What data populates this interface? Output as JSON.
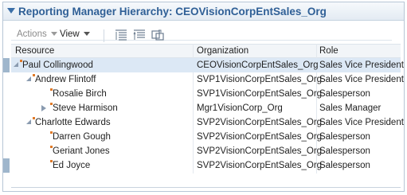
{
  "panel": {
    "title": "Reporting Manager Hierarchy: CEOVisionCorpEntSales_Org"
  },
  "toolbar": {
    "actions_label": "Actions",
    "view_label": "View",
    "icons": [
      "expand-all-icon",
      "collapse-all-icon",
      "detach-icon"
    ]
  },
  "grid": {
    "columns": [
      "Resource",
      "Organization",
      "Role"
    ],
    "rows": [
      {
        "resource": "Paul Collingwood",
        "organization": "CEOVisionCorpEntSales_Org",
        "role": "Sales Vice President"
      },
      {
        "resource": "Andrew Flintoff",
        "organization": "SVP1VisionCorpEntSales_Org",
        "role": "Sales Vice President"
      },
      {
        "resource": "Rosalie Birch",
        "organization": "SVP1VisionCorpEntSales_Org",
        "role": "Salesperson"
      },
      {
        "resource": "Steve Harmison",
        "organization": "Mgr1VisionCorp_Org",
        "role": "Sales Manager"
      },
      {
        "resource": "Charlotte Edwards",
        "organization": "SVP2VisionCorpEntSales_Org",
        "role": "Sales Vice President"
      },
      {
        "resource": "Darren Gough",
        "organization": "SVP2VisionCorpEntSales_Org",
        "role": "Salesperson"
      },
      {
        "resource": "Geriant Jones",
        "organization": "SVP2VisionCorpEntSales_Org",
        "role": "Salesperson"
      },
      {
        "resource": "Ed Joyce",
        "organization": "SVP2VisionCorpEntSales_Org",
        "role": "Salesperson"
      }
    ]
  },
  "colors": {
    "title": "#2f5f96",
    "selected_row": "#dce8f5",
    "node_marker": "#e07b2a"
  }
}
